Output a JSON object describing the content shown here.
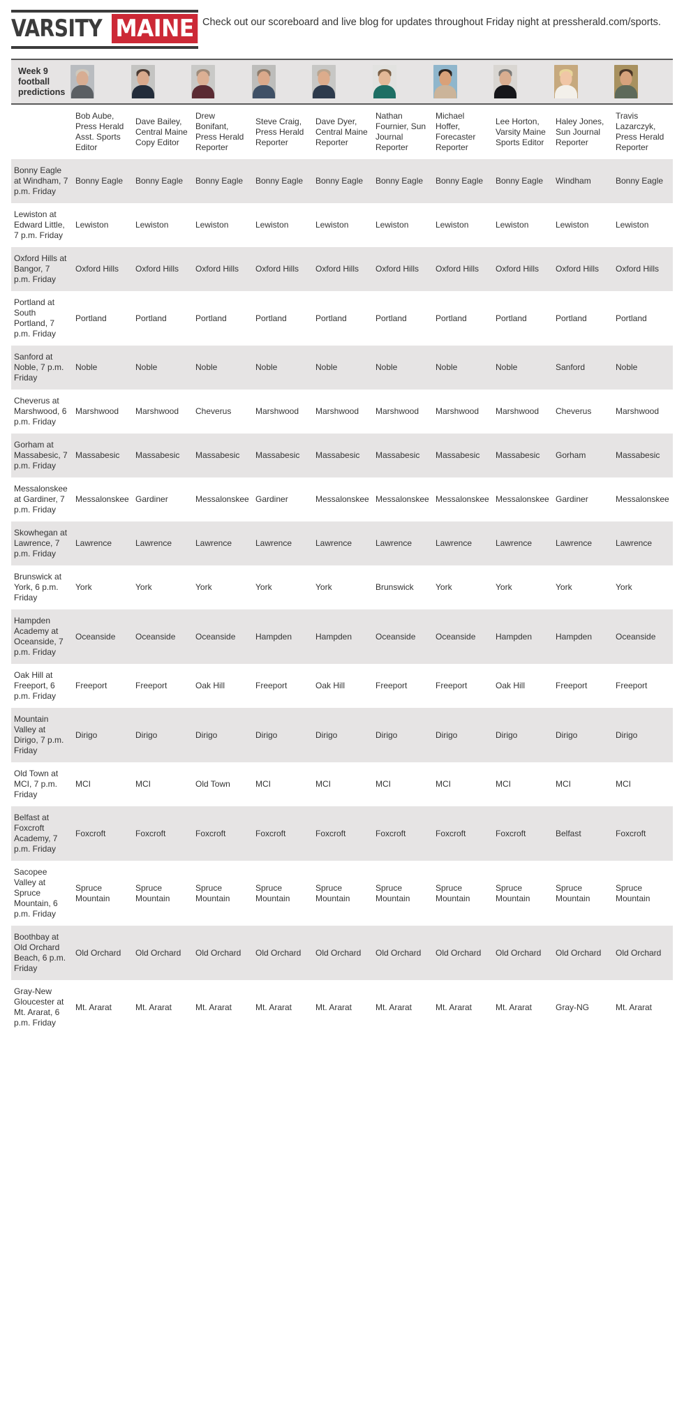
{
  "masthead": {
    "logo_varsity": "VARSITY",
    "logo_maine": "MAINE",
    "note": "Check out our scoreboard and live blog for updates throughout Friday night at pressherald.com/sports.",
    "accent_color": "#cc2936",
    "dark_color": "#3b3b3b"
  },
  "banner": {
    "title": "Week 9 football predictions",
    "avatar_icons": [
      "avatar-bob-aube",
      "avatar-dave-bailey",
      "avatar-drew-bonifant",
      "avatar-steve-craig",
      "avatar-dave-dyer",
      "avatar-nathan-fournier",
      "avatar-michael-hoffer",
      "avatar-lee-horton",
      "avatar-haley-jones",
      "avatar-travis-lazarczyk"
    ]
  },
  "table": {
    "game_column_header": "",
    "columns": [
      "Bob Aube, Press Herald Asst. Sports Editor",
      "Dave Bailey, Central Maine Copy Editor",
      "Drew Bonifant, Press Herald Reporter",
      "Steve Craig, Press Herald Reporter",
      "Dave Dyer, Central Maine Reporter",
      "Nathan Fournier, Sun Journal Reporter",
      "Michael Hoffer, Forecaster Reporter",
      "Lee Horton, Varsity Maine Sports Editor",
      "Haley Jones, Sun Journal Reporter",
      "Travis Lazarczyk, Press Herald Reporter"
    ],
    "rows": [
      {
        "game": "Bonny Eagle at Windham, 7 p.m. Friday",
        "picks": [
          "Bonny Eagle",
          "Bonny Eagle",
          "Bonny Eagle",
          "Bonny Eagle",
          "Bonny Eagle",
          "Bonny Eagle",
          "Bonny Eagle",
          "Bonny Eagle",
          "Windham",
          "Bonny Eagle"
        ]
      },
      {
        "game": "Lewiston at Edward Little, 7 p.m. Friday",
        "picks": [
          "Lewiston",
          "Lewiston",
          "Lewiston",
          "Lewiston",
          "Lewiston",
          "Lewiston",
          "Lewiston",
          "Lewiston",
          "Lewiston",
          "Lewiston"
        ]
      },
      {
        "game": "Oxford Hills at Bangor, 7 p.m. Friday",
        "picks": [
          "Oxford Hills",
          "Oxford Hills",
          "Oxford Hills",
          "Oxford Hills",
          "Oxford Hills",
          "Oxford Hills",
          "Oxford Hills",
          "Oxford Hills",
          "Oxford Hills",
          "Oxford Hills"
        ]
      },
      {
        "game": "Portland at South Portland, 7 p.m. Friday",
        "picks": [
          "Portland",
          "Portland",
          "Portland",
          "Portland",
          "Portland",
          "Portland",
          "Portland",
          "Portland",
          "Portland",
          "Portland"
        ]
      },
      {
        "game": "Sanford at Noble, 7 p.m. Friday",
        "picks": [
          "Noble",
          "Noble",
          "Noble",
          "Noble",
          "Noble",
          "Noble",
          "Noble",
          "Noble",
          "Sanford",
          "Noble"
        ]
      },
      {
        "game": "Cheverus at Marshwood, 6 p.m. Friday",
        "picks": [
          "Marshwood",
          "Marshwood",
          "Cheverus",
          "Marshwood",
          "Marshwood",
          "Marshwood",
          "Marshwood",
          "Marshwood",
          "Cheverus",
          "Marshwood"
        ]
      },
      {
        "game": "Gorham at Massabesic, 7 p.m. Friday",
        "picks": [
          "Massabesic",
          "Massabesic",
          "Massabesic",
          "Massabesic",
          "Massabesic",
          "Massabesic",
          "Massabesic",
          "Massabesic",
          "Gorham",
          "Massabesic"
        ]
      },
      {
        "game": "Messalonskee at Gardiner, 7 p.m. Friday",
        "picks": [
          "Messalonskee",
          "Gardiner",
          "Messalonskee",
          "Gardiner",
          "Messalonskee",
          "Messalonskee",
          "Messalonskee",
          "Messalonskee",
          "Gardiner",
          "Messalonskee"
        ]
      },
      {
        "game": "Skowhegan at Lawrence, 7 p.m. Friday",
        "picks": [
          "Lawrence",
          "Lawrence",
          "Lawrence",
          "Lawrence",
          "Lawrence",
          "Lawrence",
          "Lawrence",
          "Lawrence",
          "Lawrence",
          "Lawrence"
        ]
      },
      {
        "game": "Brunswick at York, 6 p.m. Friday",
        "picks": [
          "York",
          "York",
          "York",
          "York",
          "York",
          "Brunswick",
          "York",
          "York",
          "York",
          "York"
        ]
      },
      {
        "game": "Hampden Academy at Oceanside, 7 p.m. Friday",
        "picks": [
          "Oceanside",
          "Oceanside",
          "Oceanside",
          "Hampden",
          "Hampden",
          "Oceanside",
          "Oceanside",
          "Hampden",
          "Hampden",
          "Oceanside"
        ]
      },
      {
        "game": "Oak Hill at Freeport, 6 p.m. Friday",
        "picks": [
          "Freeport",
          "Freeport",
          "Oak Hill",
          "Freeport",
          "Oak Hill",
          "Freeport",
          "Freeport",
          "Oak Hill",
          "Freeport",
          "Freeport"
        ]
      },
      {
        "game": "Mountain Valley at Dirigo, 7 p.m. Friday",
        "picks": [
          "Dirigo",
          "Dirigo",
          "Dirigo",
          "Dirigo",
          "Dirigo",
          "Dirigo",
          "Dirigo",
          "Dirigo",
          "Dirigo",
          "Dirigo"
        ]
      },
      {
        "game": "Old Town at MCI, 7 p.m. Friday",
        "picks": [
          "MCI",
          "MCI",
          "Old Town",
          "MCI",
          "MCI",
          "MCI",
          "MCI",
          "MCI",
          "MCI",
          "MCI"
        ]
      },
      {
        "game": "Belfast at Foxcroft Academy, 7 p.m. Friday",
        "picks": [
          "Foxcroft",
          "Foxcroft",
          "Foxcroft",
          "Foxcroft",
          "Foxcroft",
          "Foxcroft",
          "Foxcroft",
          "Foxcroft",
          "Belfast",
          "Foxcroft"
        ]
      },
      {
        "game": "Sacopee Valley at Spruce Mountain, 6 p.m. Friday",
        "picks": [
          "Spruce Mountain",
          "Spruce Mountain",
          "Spruce Mountain",
          "Spruce Mountain",
          "Spruce Mountain",
          "Spruce Mountain",
          "Spruce Mountain",
          "Spruce Mountain",
          "Spruce Mountain",
          "Spruce Mountain"
        ]
      },
      {
        "game": "Boothbay at Old Orchard Beach, 6 p.m. Friday",
        "picks": [
          "Old Orchard",
          "Old Orchard",
          "Old Orchard",
          "Old Orchard",
          "Old Orchard",
          "Old Orchard",
          "Old Orchard",
          "Old Orchard",
          "Old Orchard",
          "Old Orchard"
        ]
      },
      {
        "game": "Gray-New Gloucester at Mt. Ararat, 6 p.m. Friday",
        "picks": [
          "Mt. Ararat",
          "Mt. Ararat",
          "Mt. Ararat",
          "Mt. Ararat",
          "Mt. Ararat",
          "Mt. Ararat",
          "Mt. Ararat",
          "Mt. Ararat",
          "Gray-NG",
          "Mt. Ararat"
        ]
      }
    ]
  }
}
